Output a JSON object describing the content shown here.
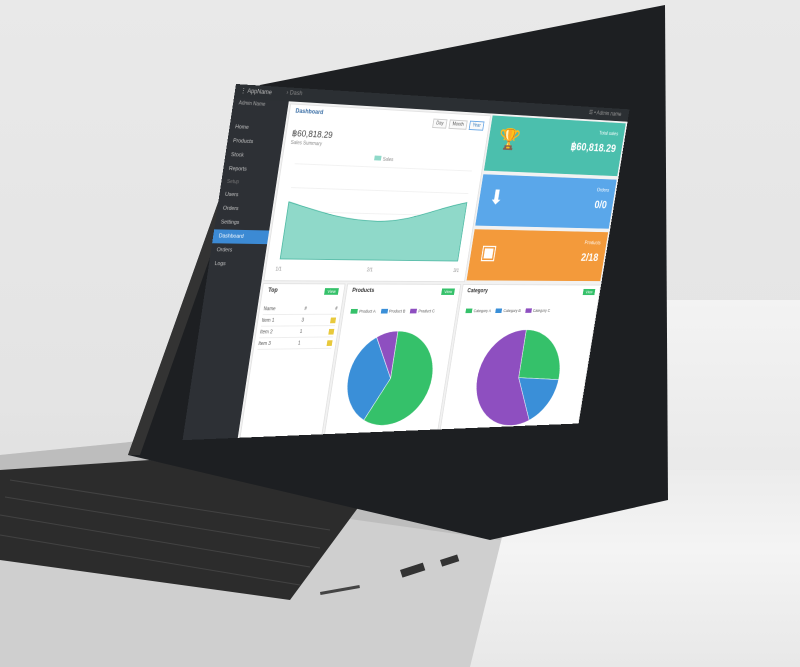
{
  "scene": {
    "background_color": "#e6e6e6",
    "laptop_body_color": "#c9c9c9",
    "bezel_color": "#1d1f22"
  },
  "app": {
    "brand": "⋮ AppName",
    "breadcrumb": "› Dash",
    "user_label": "☰ • Admin name"
  },
  "sidebar": {
    "profile": "Admin Name",
    "items": [
      {
        "label": "Home",
        "group": false,
        "active": false
      },
      {
        "label": "Products",
        "group": false,
        "active": false
      },
      {
        "label": "Stock",
        "group": false,
        "active": false
      },
      {
        "label": "Reports",
        "group": false,
        "active": false
      },
      {
        "label": "Setup",
        "group": true,
        "active": false
      },
      {
        "label": "Users",
        "group": false,
        "active": false
      },
      {
        "label": "Orders",
        "group": false,
        "active": false
      },
      {
        "label": "Settings",
        "group": false,
        "active": false
      },
      {
        "label": "Dashboard",
        "group": false,
        "active": true
      },
      {
        "label": "Orders",
        "group": false,
        "active": false
      },
      {
        "label": "Logs",
        "group": false,
        "active": false
      }
    ]
  },
  "sales_panel": {
    "title": "Dashboard",
    "tabs": [
      "Day",
      "Month",
      "Year"
    ],
    "active_tab": 2,
    "value": "฿60,818.29",
    "subtitle": "Sales Summary"
  },
  "tiles": [
    {
      "label": "Total sales",
      "value": "฿60,818.29",
      "color": "#4bbfad",
      "icon": "trophy-icon",
      "glyph": "🏆"
    },
    {
      "label": "Orders",
      "value": "0/0",
      "color": "#5aa7ea",
      "icon": "download-tray-icon",
      "glyph": "⬇"
    },
    {
      "label": "Products",
      "value": "2/18",
      "color": "#f39a3b",
      "icon": "box-icon",
      "glyph": "▣"
    }
  ],
  "chart_data": [
    {
      "type": "area",
      "x": [
        "1/1",
        "2/1",
        "3/1"
      ],
      "values": [
        60,
        42,
        65
      ],
      "legend": "Sales",
      "ylim": [
        0,
        100
      ],
      "color": "#8fd9c9",
      "grid": true
    },
    {
      "type": "pie",
      "title": "Products",
      "labels": [
        "Product A",
        "Product B",
        "Product C"
      ],
      "values": [
        58,
        34,
        8
      ],
      "colors": [
        "#35c16a",
        "#3a8fd8",
        "#8e4fc0"
      ]
    },
    {
      "type": "pie",
      "title": "Category",
      "labels": [
        "Category A",
        "Category B",
        "Category C"
      ],
      "values": [
        26,
        17,
        57
      ],
      "colors": [
        "#35c16a",
        "#3a8fd8",
        "#8e4fc0"
      ]
    }
  ],
  "top_products": {
    "title": "Top",
    "button": "View",
    "header": [
      "Name",
      "#",
      "#"
    ],
    "rows": [
      {
        "name": "Item 1",
        "qty": "3"
      },
      {
        "name": "Item 2",
        "qty": "1"
      },
      {
        "name": "Item 3",
        "qty": "1"
      }
    ]
  },
  "pie_panels": [
    {
      "title": "Products",
      "button": "View"
    },
    {
      "title": "Category",
      "button": "View"
    }
  ]
}
